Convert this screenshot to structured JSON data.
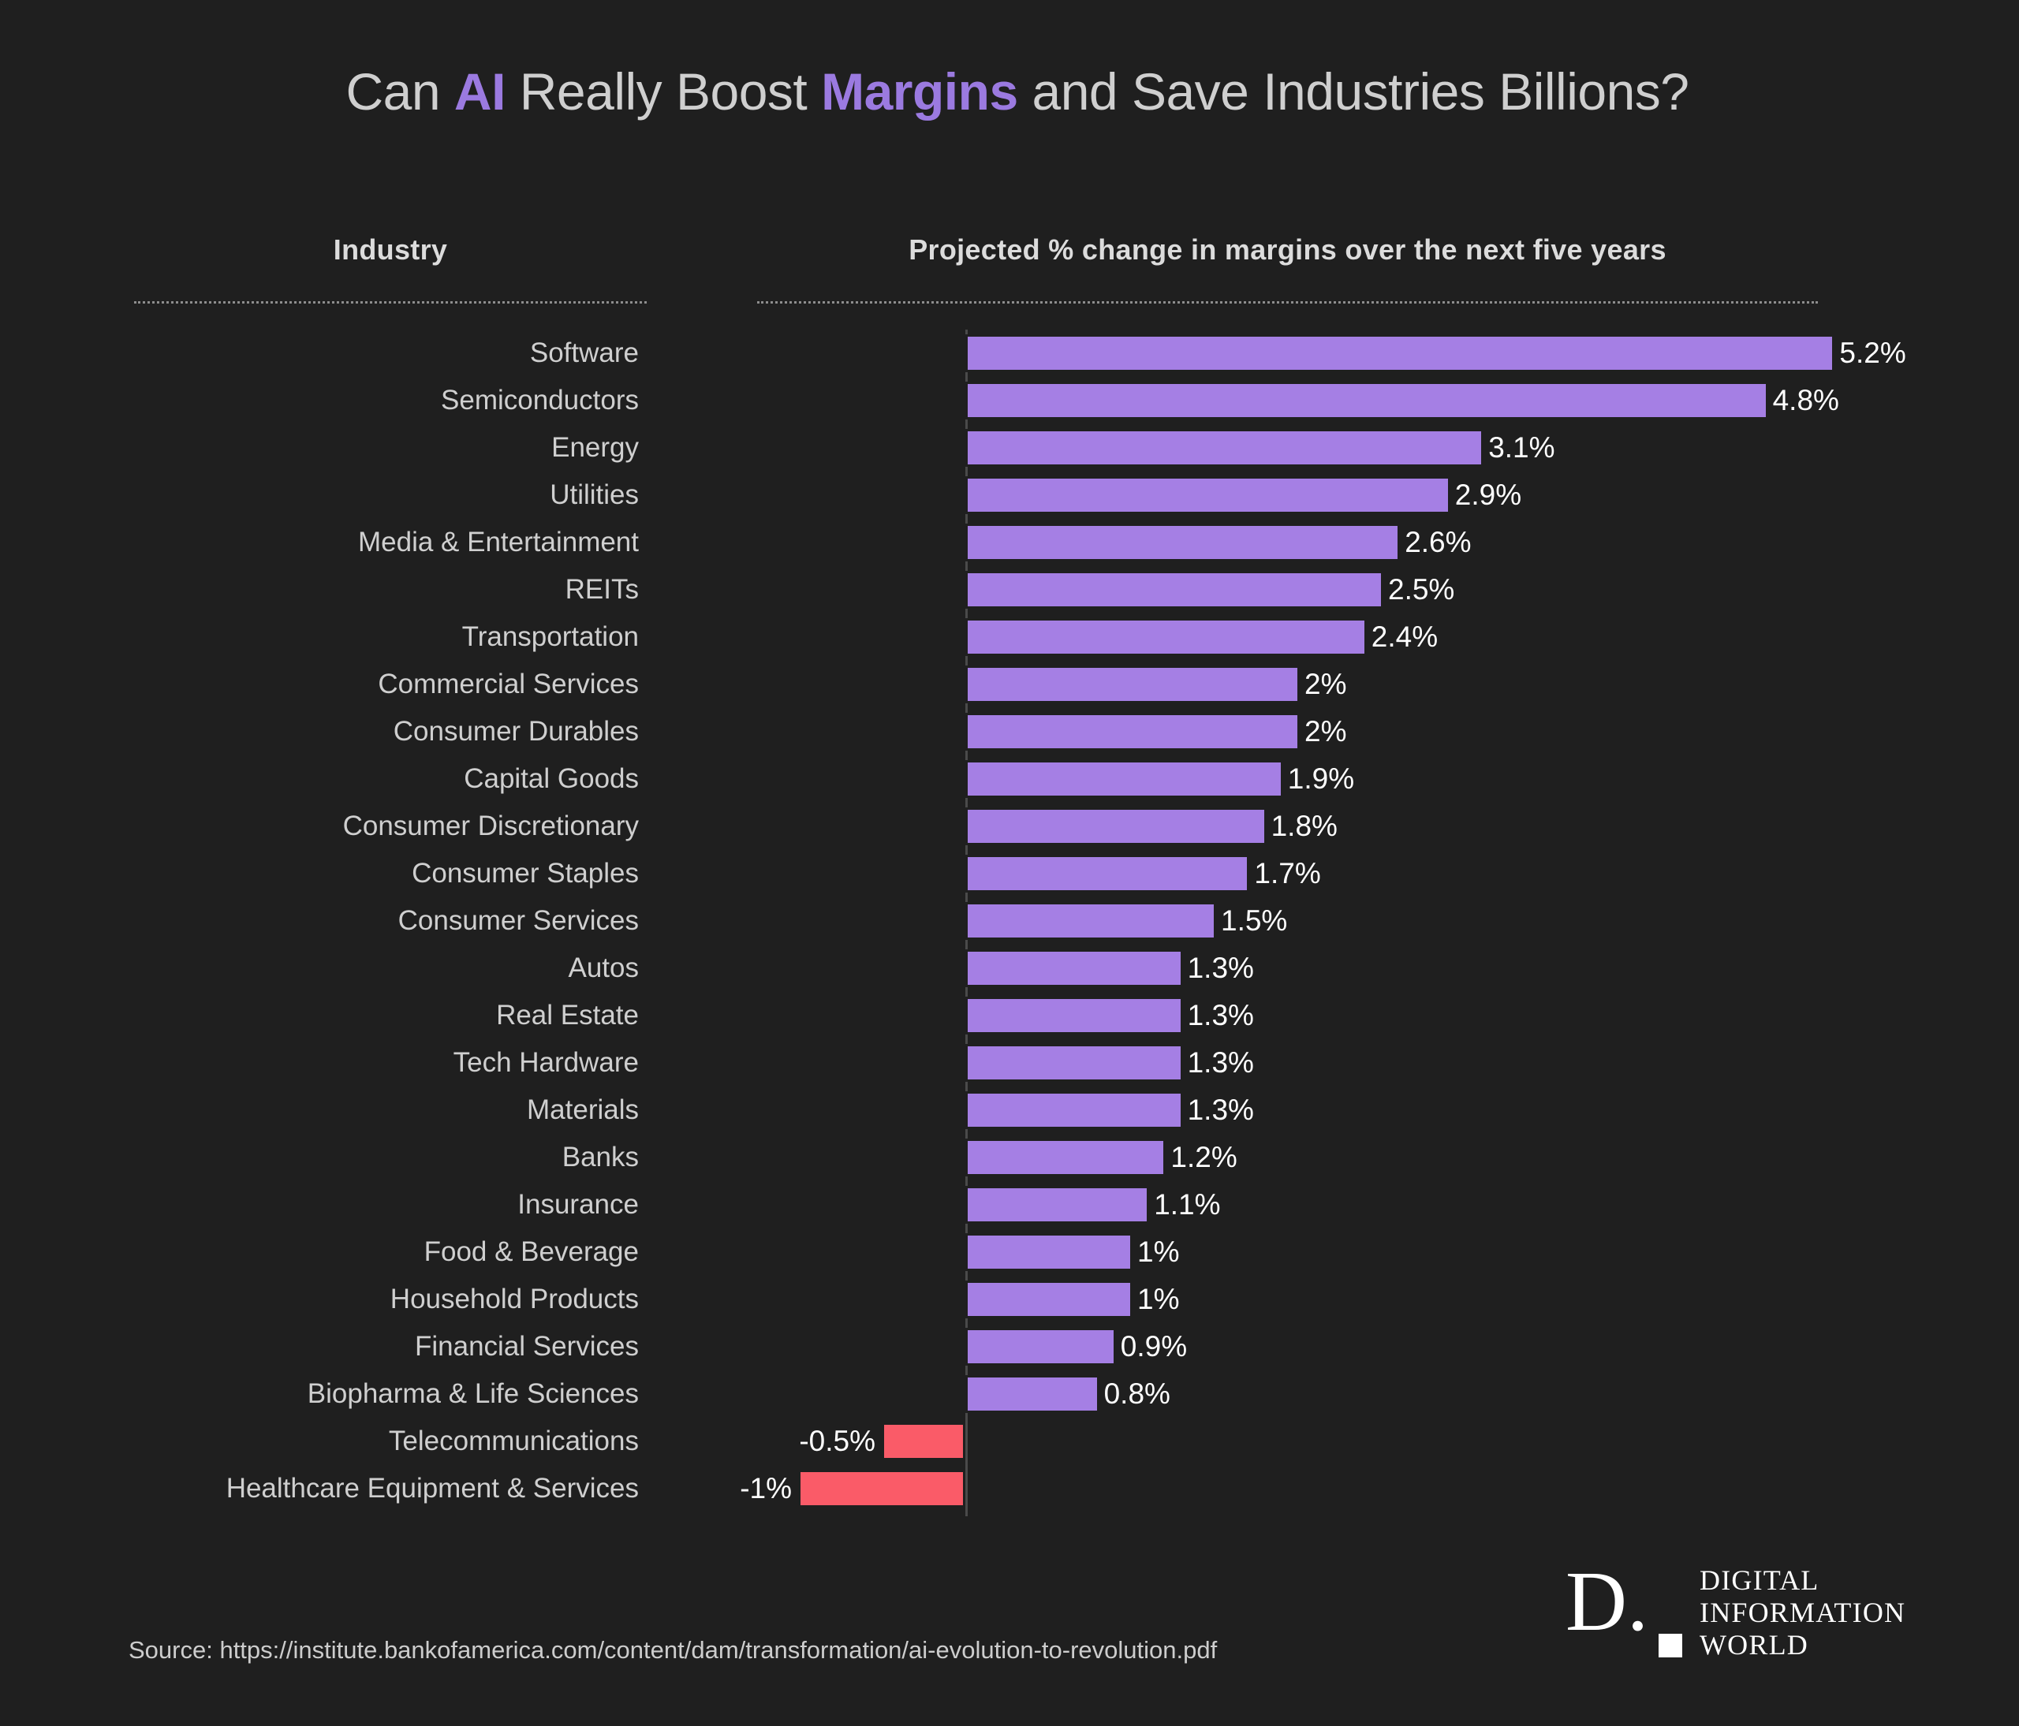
{
  "title": {
    "part1": "Can ",
    "hl1": "AI",
    "part2": " Really Boost ",
    "hl2": "Margins",
    "part3": " and Save Industries Billions?"
  },
  "headers": {
    "industry": "Industry",
    "metric": "Projected % change in margins over the next five years"
  },
  "source": "Source: https://institute.bankofamerica.com/content/dam/transformation/ai-evolution-to-revolution.pdf",
  "logo": {
    "mark": "D.",
    "line1": "DIGITAL",
    "line2": "INFORMATION",
    "line3": "WORLD"
  },
  "colors": {
    "background": "#1f1f1f",
    "positive_bar": "#a57fe4",
    "negative_bar": "#fa5b68",
    "accent_text": "#9b7ae0",
    "label_text": "#cfcfcf",
    "value_text": "#ffffff"
  },
  "chart_data": {
    "type": "bar",
    "orientation": "horizontal",
    "title": "Can AI Really Boost Margins and Save Industries Billions?",
    "subtitle": "Projected % change in margins over the next five years",
    "xlabel": "Projected % change in margins over the next five years",
    "ylabel": "Industry",
    "grid": false,
    "legend": "none",
    "xlim": [
      -1.2,
      5.6
    ],
    "categories": [
      "Software",
      "Semiconductors",
      "Energy",
      "Utilities",
      "Media & Entertainment",
      "REITs",
      "Transportation",
      "Commercial Services",
      "Consumer Durables",
      "Capital Goods",
      "Consumer Discretionary",
      "Consumer Staples",
      "Consumer Services",
      "Autos",
      "Real Estate",
      "Tech Hardware",
      "Materials",
      "Banks",
      "Insurance",
      "Food & Beverage",
      "Household Products",
      "Financial Services",
      "Biopharma & Life Sciences",
      "Telecommunications",
      "Healthcare Equipment & Services"
    ],
    "values": [
      5.2,
      4.8,
      3.1,
      2.9,
      2.6,
      2.5,
      2.4,
      2,
      2,
      1.9,
      1.8,
      1.7,
      1.5,
      1.3,
      1.3,
      1.3,
      1.3,
      1.2,
      1.1,
      1,
      1,
      0.9,
      0.8,
      -0.5,
      -1
    ],
    "labels": [
      "5.2%",
      "4.8%",
      "3.1%",
      "2.9%",
      "2.6%",
      "2.5%",
      "2.4%",
      "2%",
      "2%",
      "1.9%",
      "1.8%",
      "1.7%",
      "1.5%",
      "1.3%",
      "1.3%",
      "1.3%",
      "1.3%",
      "1.2%",
      "1.1%",
      "1%",
      "1%",
      "0.9%",
      "0.8%",
      "-0.5%",
      "-1%"
    ]
  }
}
